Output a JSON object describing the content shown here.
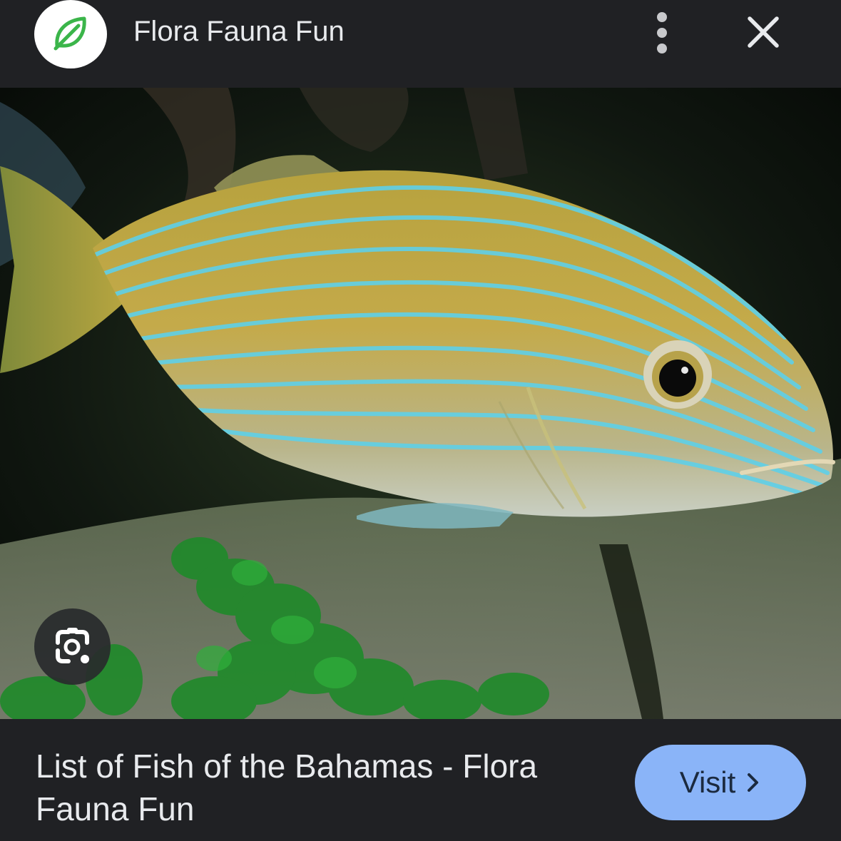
{
  "header": {
    "site_name": "Flora Fauna Fun",
    "logo_icon": "leaf-icon",
    "more_icon": "more-vert-icon",
    "close_icon": "close-icon"
  },
  "image": {
    "lens_icon": "google-lens-icon"
  },
  "footer": {
    "title": "List of Fish of the Bahamas - Flora Fauna Fun",
    "visit_label": "Visit",
    "visit_icon": "chevron-right-icon"
  },
  "colors": {
    "background": "#202124",
    "text": "#e8eaed",
    "visit_button": "#8ab4f8",
    "logo_leaf": "#34a853"
  }
}
